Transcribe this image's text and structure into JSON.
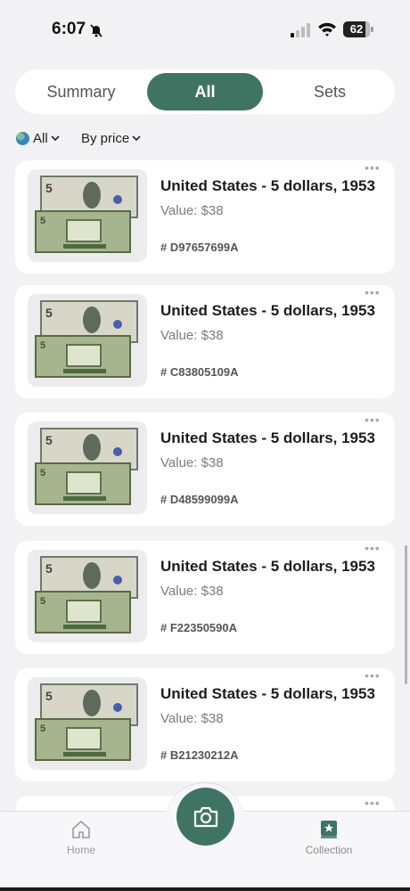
{
  "status_bar": {
    "time": "6:07",
    "battery": "62"
  },
  "segments": {
    "summary": "Summary",
    "all": "All",
    "sets": "Sets",
    "selected": "All"
  },
  "filters": {
    "region": "All",
    "sort": "By price"
  },
  "items": [
    {
      "title": "United States - 5 dollars, 1953",
      "value": "Value: $38",
      "serial": "# D97657699A"
    },
    {
      "title": "United States - 5 dollars, 1953",
      "value": "Value: $38",
      "serial": "# C83805109A"
    },
    {
      "title": "United States - 5 dollars, 1953",
      "value": "Value: $38",
      "serial": "# D48599099A"
    },
    {
      "title": "United States - 5 dollars, 1953",
      "value": "Value: $38",
      "serial": "# F22350590A"
    },
    {
      "title": "United States - 5 dollars, 1953",
      "value": "Value: $38",
      "serial": "# B21230212A"
    }
  ],
  "tabbar": {
    "home": "Home",
    "collection": "Collection"
  },
  "colors": {
    "accent": "#3f7463",
    "background": "#f2f2f4"
  }
}
